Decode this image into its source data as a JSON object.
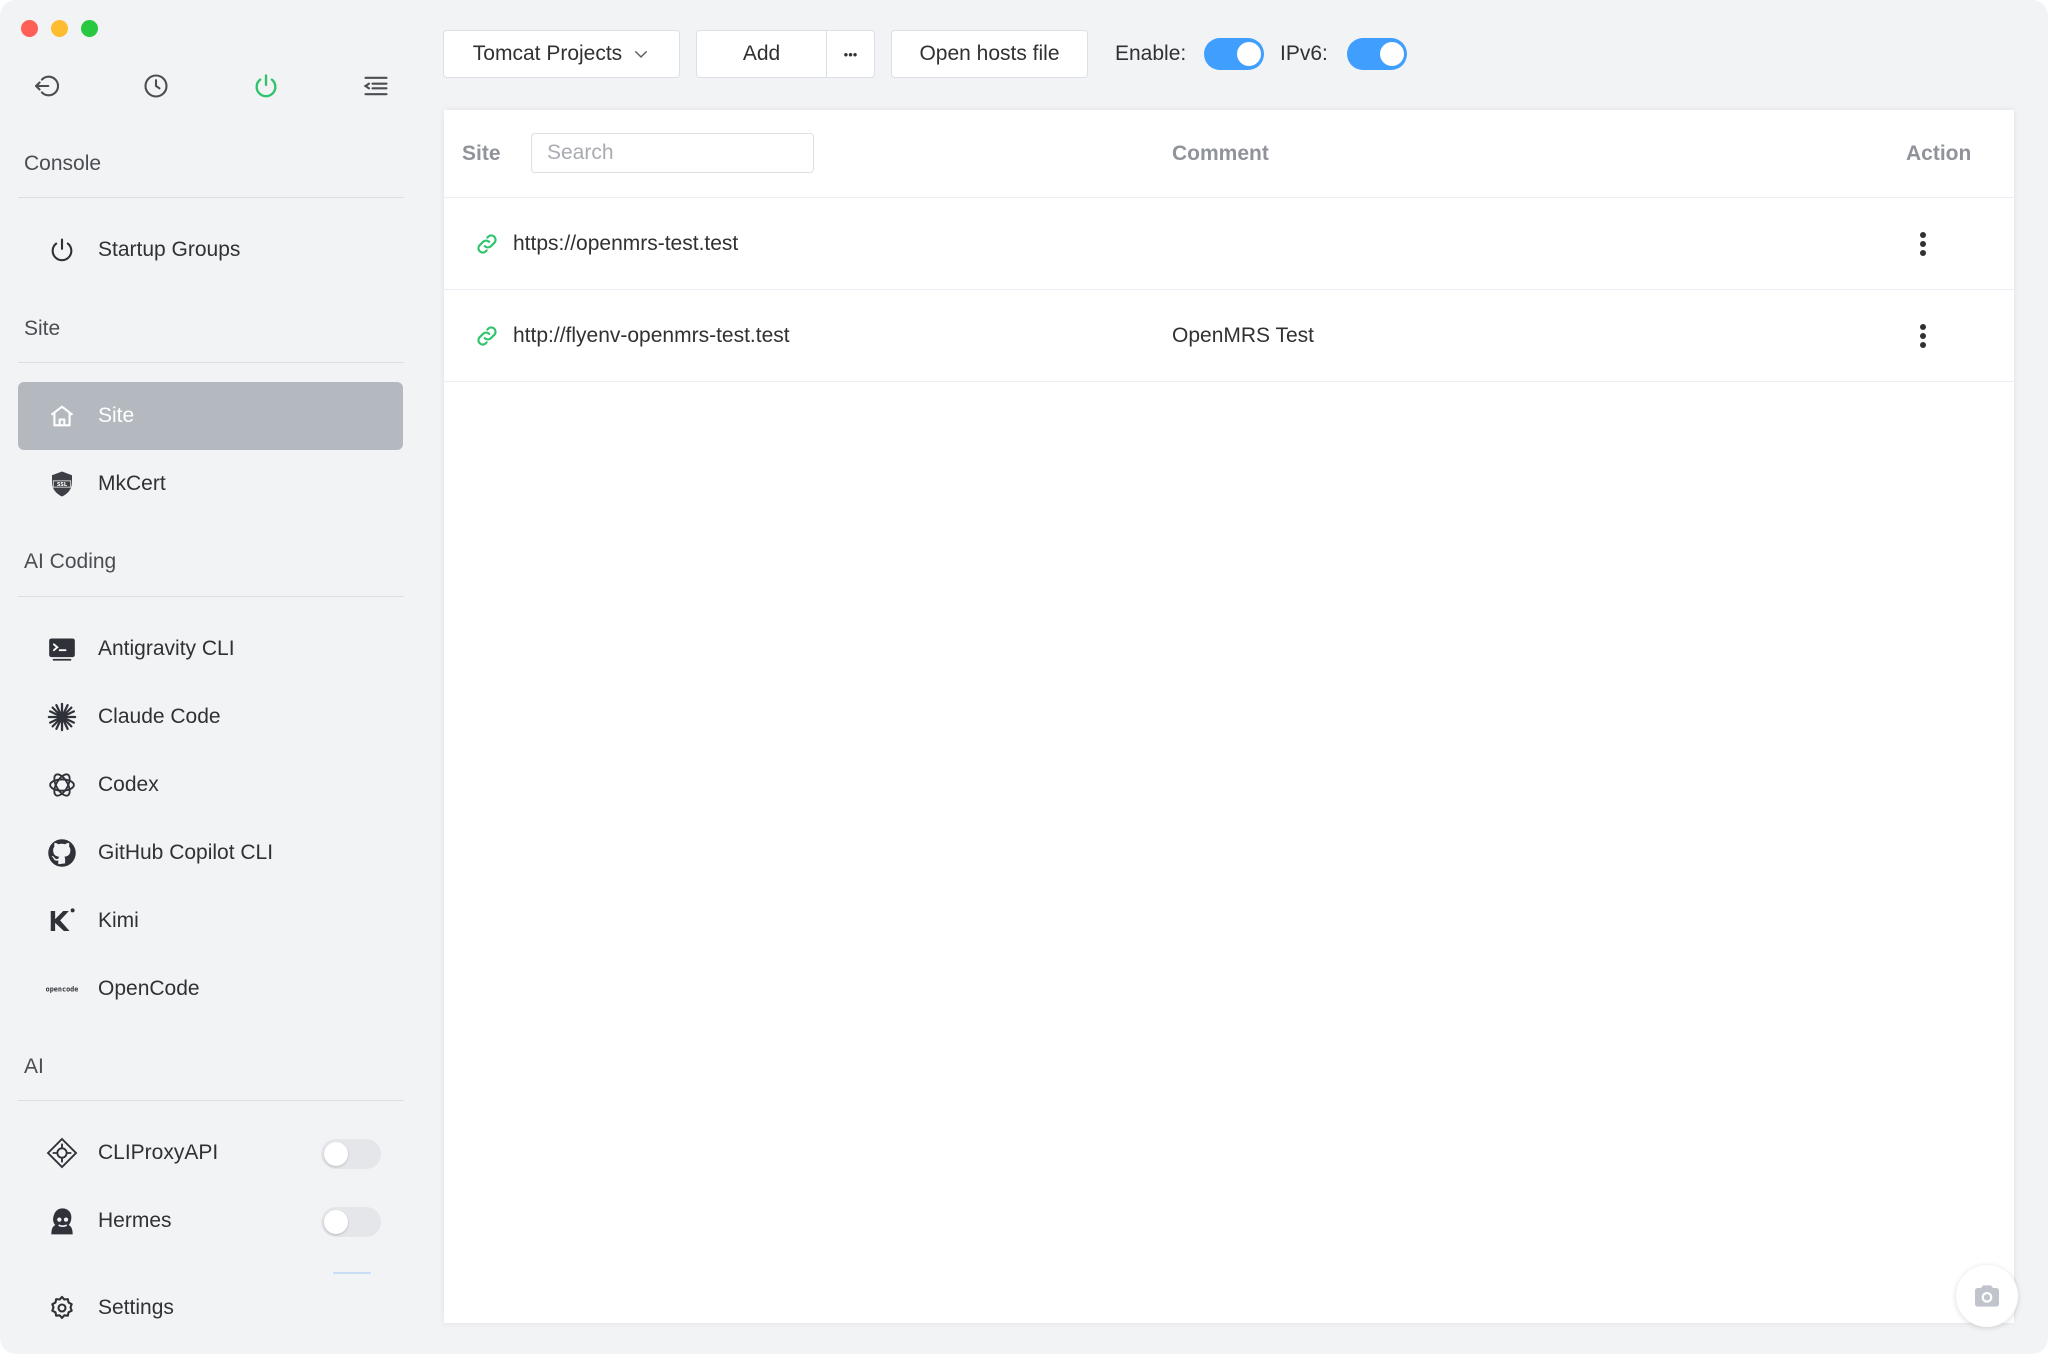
{
  "window": {
    "traffic_lights": [
      "close",
      "minimize",
      "maximize"
    ]
  },
  "sidebar": {
    "tools": [
      {
        "icon": "logout-icon"
      },
      {
        "icon": "clock-icon"
      },
      {
        "icon": "power-icon",
        "color": "#2fc36b"
      },
      {
        "icon": "menu-fold-icon"
      }
    ],
    "sections": {
      "console": "Console",
      "site": "Site",
      "ai_coding": "AI Coding",
      "ai": "AI"
    },
    "items": {
      "startup_groups": "Startup Groups",
      "site": "Site",
      "mkcert": "MkCert",
      "antigravity": "Antigravity CLI",
      "claude_code": "Claude Code",
      "codex": "Codex",
      "github_copilot": "GitHub Copilot CLI",
      "kimi": "Kimi",
      "opencode": "OpenCode",
      "cliproxyapi": "CLIProxyAPI",
      "hermes": "Hermes",
      "settings": "Settings"
    },
    "mkcert_badge": "SSL",
    "opencode_logo": "opencode",
    "toggles": {
      "cliproxyapi": false,
      "hermes": false
    }
  },
  "toolbar": {
    "project_select": "Tomcat Projects",
    "add": "Add",
    "more": "•••",
    "open_hosts": "Open hosts file",
    "enable_label": "Enable:",
    "ipv6_label": "IPv6:",
    "enable_on": true,
    "ipv6_on": true,
    "accent_color": "#409eff"
  },
  "table": {
    "columns": {
      "site": "Site",
      "comment": "Comment",
      "action": "Action"
    },
    "search_placeholder": "Search",
    "rows": [
      {
        "site": "https://openmrs-test.test",
        "comment": ""
      },
      {
        "site": "http://flyenv-openmrs-test.test",
        "comment": "OpenMRS Test"
      }
    ],
    "link_icon_color": "#2fc36b"
  }
}
